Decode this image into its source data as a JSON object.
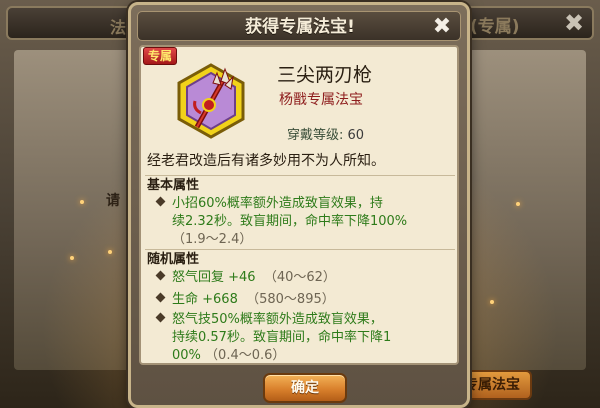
{
  "background": {
    "title_left": "法",
    "title_right": "(专属)",
    "close_glyph": "✖",
    "hint_text": "请",
    "bottom_button_label": "专属法宝"
  },
  "dialog": {
    "title": "获得专属法宝!",
    "close_glyph": "✖",
    "confirm_label": "确定"
  },
  "item": {
    "badge": "专属",
    "icon": "spear-treasure-icon",
    "name": "三尖两刃枪",
    "owner": "杨戬专属法宝",
    "level_label": "穿戴等级:",
    "level_value": "60",
    "description": "经老君改造后有诸多妙用不为人所知。"
  },
  "basic_attrs": {
    "heading": "基本属性",
    "lines": [
      "小招60%概率额外造成致盲效果，持",
      "续2.32秒。致盲期间，命中率下降100%",
      "（1.9～2.4）"
    ]
  },
  "random_attrs": {
    "heading": "随机属性",
    "items": [
      {
        "name": "怒气回复 +46",
        "range": "（40～62）"
      },
      {
        "name": "生命 +668",
        "range": "（580～895）"
      }
    ],
    "skill_lines": [
      "怒气技50%概率额外造成致盲效果，",
      "持续0.57秒。致盲期间，命中率下降1",
      "00%",
      "（0.4～0.6）"
    ]
  },
  "colors": {
    "attr_green": "#2e7b1a",
    "owner_red": "#8e1d1d",
    "badge_red": "#c62828",
    "button_orange": "#d9802c"
  }
}
